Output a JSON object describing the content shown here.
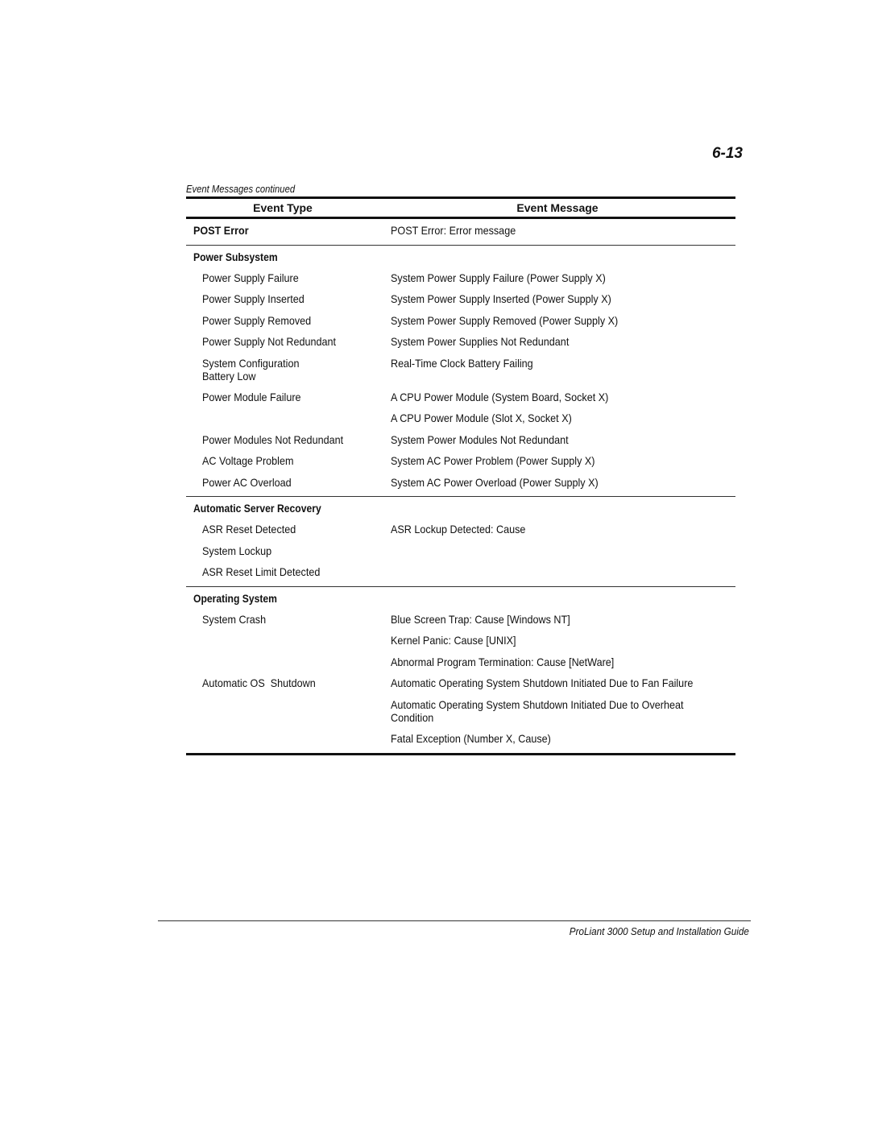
{
  "page": {
    "number": "6-13",
    "caption": "Event Messages continued",
    "footer": "ProLiant 3000 Setup and Installation Guide"
  },
  "table": {
    "headers": {
      "type": "Event Type",
      "message": "Event Message"
    },
    "post": {
      "type": "POST Error",
      "message": "POST Error: Error message"
    },
    "sections": [
      {
        "title": "Power Subsystem",
        "rows": [
          {
            "type": "Power Supply Failure",
            "message": "System Power Supply Failure (Power Supply X)"
          },
          {
            "type": "Power Supply Inserted",
            "message": "System Power Supply Inserted (Power Supply X)"
          },
          {
            "type": "Power Supply Removed",
            "message": "System Power Supply Removed (Power Supply X)"
          },
          {
            "type": "Power Supply Not Redundant",
            "message": "System Power Supplies Not Redundant"
          },
          {
            "type": "System Configuration",
            "type2": "Battery Low",
            "message": "Real-Time Clock Battery Failing"
          },
          {
            "type": "Power Module Failure",
            "message": "A CPU Power Module (System Board, Socket X)"
          },
          {
            "type": "",
            "message": "A CPU Power Module (Slot X, Socket X)"
          },
          {
            "type": "Power Modules Not Redundant",
            "message": "System Power Modules Not Redundant"
          },
          {
            "type": "AC Voltage Problem",
            "message": "System AC Power Problem (Power Supply X)"
          },
          {
            "type": "Power AC Overload",
            "message": "System AC Power Overload (Power Supply X)"
          }
        ]
      },
      {
        "title": "Automatic Server Recovery",
        "rows": [
          {
            "type": "ASR Reset Detected",
            "message": "ASR Lockup Detected: Cause"
          },
          {
            "type": "System Lockup",
            "message": ""
          },
          {
            "type": "ASR Reset Limit Detected",
            "message": ""
          }
        ]
      },
      {
        "title": "Operating System",
        "rows": [
          {
            "type": "System Crash",
            "message": "Blue Screen Trap: Cause [Windows NT]"
          },
          {
            "type": "",
            "message": "Kernel Panic: Cause [UNIX]"
          },
          {
            "type": "",
            "message": "Abnormal Program Termination: Cause [NetWare]"
          },
          {
            "type": "Automatic OS  Shutdown",
            "message": "Automatic Operating System Shutdown Initiated Due to Fan Failure"
          },
          {
            "type": "",
            "message": "Automatic Operating System Shutdown Initiated Due to Overheat",
            "message2": "Condition"
          },
          {
            "type": "",
            "message": "Fatal Exception (Number X, Cause)"
          }
        ]
      }
    ]
  }
}
